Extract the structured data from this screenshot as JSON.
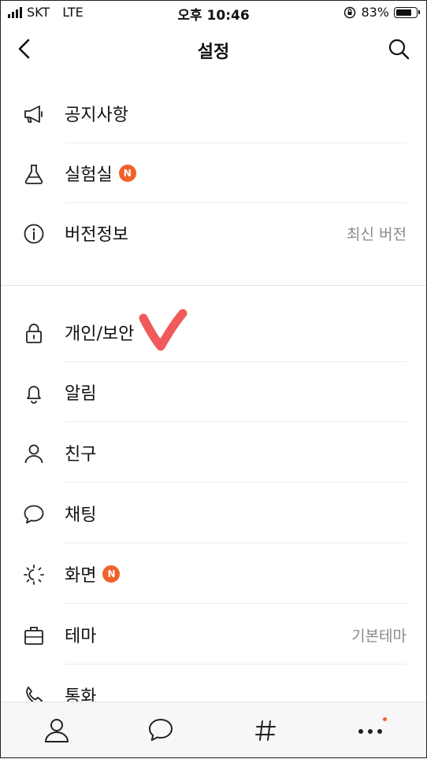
{
  "status_bar": {
    "carrier": "SKT",
    "network": "LTE",
    "time": "오후 10:46",
    "battery_percent": "83%",
    "battery_level": 0.83
  },
  "header": {
    "title": "설정",
    "back_icon": "chevron-left-icon",
    "search_icon": "search-icon"
  },
  "menu": {
    "section1": [
      {
        "label": "공지사항",
        "icon": "megaphone-icon"
      },
      {
        "label": "실험실",
        "icon": "flask-icon",
        "badge": "N"
      },
      {
        "label": "버전정보",
        "icon": "info-icon",
        "value": "최신 버전"
      }
    ],
    "section2": [
      {
        "label": "개인/보안",
        "icon": "lock-icon"
      },
      {
        "label": "알림",
        "icon": "bell-icon"
      },
      {
        "label": "친구",
        "icon": "person-icon"
      },
      {
        "label": "채팅",
        "icon": "chat-bubble-icon"
      },
      {
        "label": "화면",
        "icon": "screen-brightness-icon",
        "badge": "N"
      },
      {
        "label": "테마",
        "icon": "theme-icon",
        "value": "기본테마"
      },
      {
        "label": "통화",
        "icon": "phone-icon"
      }
    ]
  },
  "tab_bar": {
    "tabs": [
      {
        "icon": "person-icon"
      },
      {
        "icon": "chat-bubble-icon"
      },
      {
        "icon": "hashtag-icon"
      },
      {
        "icon": "more-icon",
        "has_dot": true
      }
    ]
  },
  "colors": {
    "badge": "#f0612b",
    "annotation": "#f05a5a",
    "secondary_text": "#8a8a8a"
  }
}
